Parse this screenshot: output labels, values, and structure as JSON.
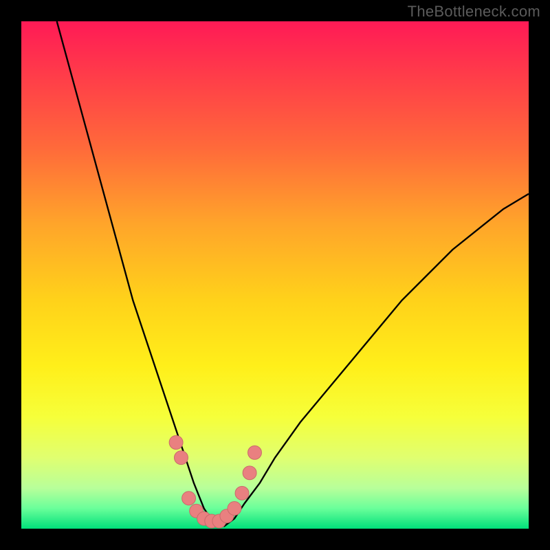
{
  "watermark": "TheBottleneck.com",
  "colors": {
    "frame_border": "#000000",
    "curve": "#000000",
    "marker_fill": "#e98080",
    "marker_stroke": "#c96a6a",
    "gradient_top": "#ff1a56",
    "gradient_bottom": "#00e07a"
  },
  "chart_data": {
    "type": "line",
    "title": "",
    "xlabel": "",
    "ylabel": "",
    "xlim": [
      0,
      100
    ],
    "ylim": [
      0,
      100
    ],
    "legend": false,
    "grid": false,
    "series": [
      {
        "name": "bottleneck-curve",
        "note": "Asymmetric V-shaped curve; minimum ~0 around x≈37. Left branch reaches y=100 near x≈7; right branch reaches y≈66 at x=100.",
        "x": [
          7,
          10,
          13,
          16,
          19,
          22,
          25,
          28,
          30,
          32,
          34,
          36,
          38,
          40,
          42,
          44,
          47,
          50,
          55,
          60,
          65,
          70,
          75,
          80,
          85,
          90,
          95,
          100
        ],
        "y": [
          100,
          89,
          78,
          67,
          56,
          45,
          36,
          27,
          21,
          15,
          9,
          4,
          1,
          0.5,
          2,
          5,
          9,
          14,
          21,
          27,
          33,
          39,
          45,
          50,
          55,
          59,
          63,
          66
        ]
      }
    ],
    "markers": {
      "name": "highlight-points",
      "note": "Pink/salmon markers near the bottom of the curve.",
      "points": [
        {
          "x": 30.5,
          "y": 17
        },
        {
          "x": 31.5,
          "y": 14
        },
        {
          "x": 33.0,
          "y": 6
        },
        {
          "x": 34.5,
          "y": 3.5
        },
        {
          "x": 36.0,
          "y": 2
        },
        {
          "x": 37.5,
          "y": 1.5
        },
        {
          "x": 39.0,
          "y": 1.5
        },
        {
          "x": 40.5,
          "y": 2.5
        },
        {
          "x": 42.0,
          "y": 4
        },
        {
          "x": 43.5,
          "y": 7
        },
        {
          "x": 45.0,
          "y": 11
        },
        {
          "x": 46.0,
          "y": 15
        }
      ]
    }
  }
}
